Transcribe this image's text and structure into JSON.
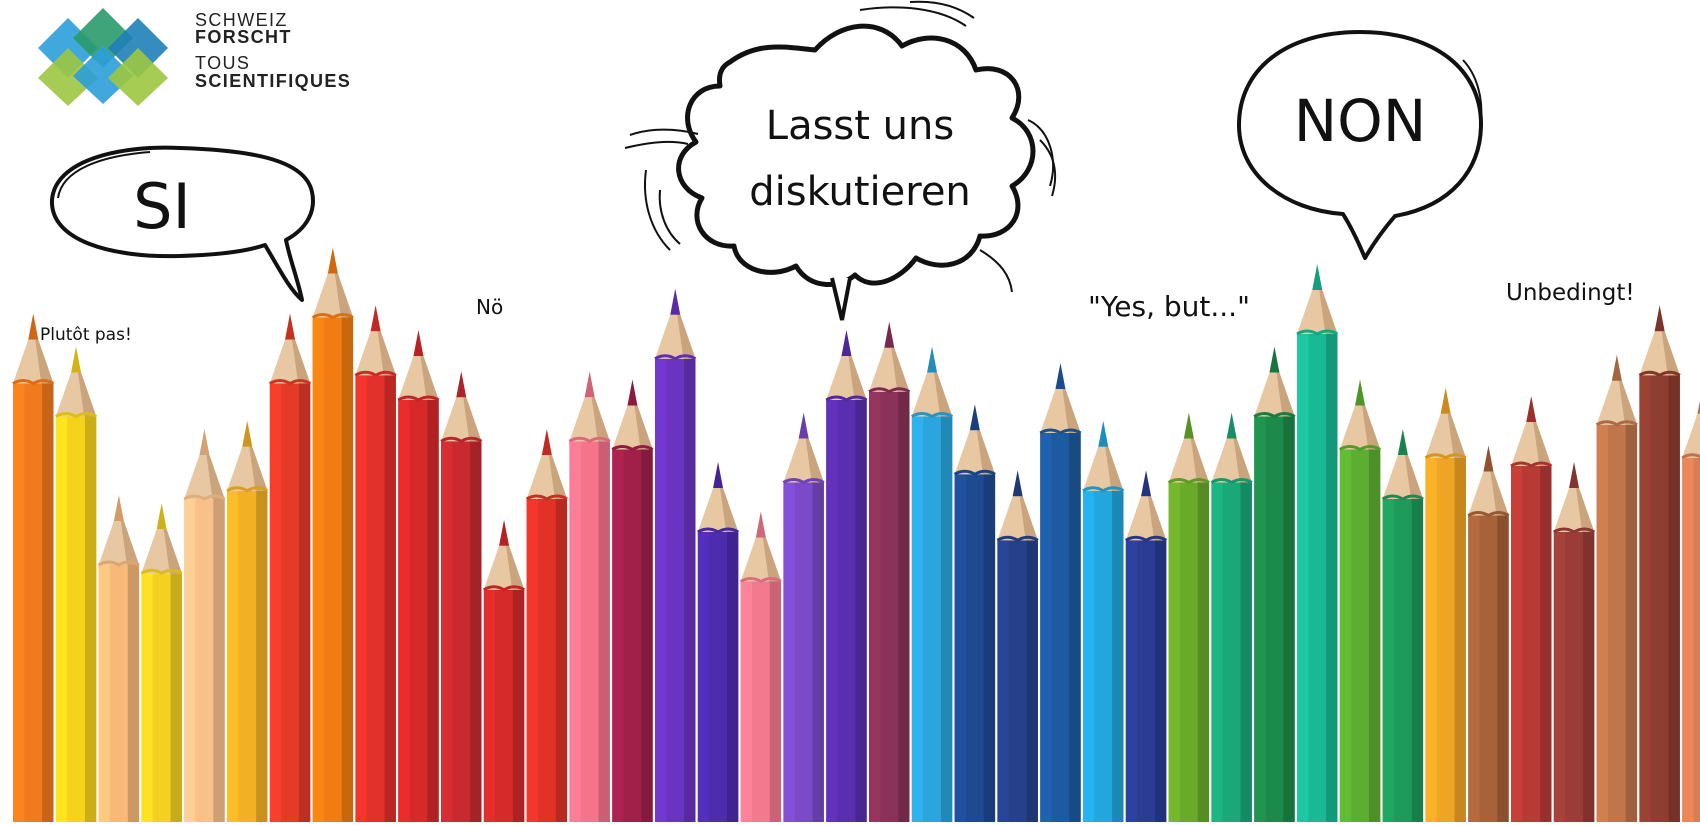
{
  "logo": {
    "line1": "SCHWEIZ",
    "line2": "FORSCHT",
    "line3": "TOUS",
    "line4": "SCIENTIFIQUES",
    "colors": [
      "#2b9fd9",
      "#9cc741",
      "#2a9a6a",
      "#1f7fb8"
    ]
  },
  "bubbles": {
    "si": "SI",
    "discuss_line1": "Lasst uns",
    "discuss_line2": "diskutieren",
    "non": "NON"
  },
  "captions": {
    "plutot": "Plutôt pas!",
    "no": "Nö",
    "yes_but": "\"Yes, but...\"",
    "unbedingt": "Unbedingt!"
  },
  "pencils": [
    {
      "color": "#f07a1c",
      "tip": 0.62
    },
    {
      "color": "#f6d31a",
      "tip": 0.58
    },
    {
      "color": "#f8b878",
      "tip": 0.4
    },
    {
      "color": "#f4d020",
      "tip": 0.39
    },
    {
      "color": "#f9c08a",
      "tip": 0.48
    },
    {
      "color": "#f2b024",
      "tip": 0.49
    },
    {
      "color": "#e43a28",
      "tip": 0.62
    },
    {
      "color": "#f27c12",
      "tip": 0.7
    },
    {
      "color": "#e2302c",
      "tip": 0.63
    },
    {
      "color": "#d8282a",
      "tip": 0.6
    },
    {
      "color": "#c82a30",
      "tip": 0.55
    },
    {
      "color": "#d42a2a",
      "tip": 0.37
    },
    {
      "color": "#e23228",
      "tip": 0.48
    },
    {
      "color": "#f5748c",
      "tip": 0.55
    },
    {
      "color": "#a0204a",
      "tip": 0.54
    },
    {
      "color": "#6a34c0",
      "tip": 0.65
    },
    {
      "color": "#4e2cae",
      "tip": 0.44
    },
    {
      "color": "#f27a8e",
      "tip": 0.38
    },
    {
      "color": "#7a4ac8",
      "tip": 0.5
    },
    {
      "color": "#5a2eb0",
      "tip": 0.6
    },
    {
      "color": "#8a3258",
      "tip": 0.61
    },
    {
      "color": "#2aa6dc",
      "tip": 0.58
    },
    {
      "color": "#1e4a92",
      "tip": 0.51
    },
    {
      "color": "#26418a",
      "tip": 0.43
    },
    {
      "color": "#1e5aa0",
      "tip": 0.56
    },
    {
      "color": "#22a6de",
      "tip": 0.49
    },
    {
      "color": "#2a3c94",
      "tip": 0.43
    },
    {
      "color": "#6aaa2a",
      "tip": 0.5
    },
    {
      "color": "#1aa878",
      "tip": 0.5
    },
    {
      "color": "#1c8a4a",
      "tip": 0.58
    },
    {
      "color": "#1ab894",
      "tip": 0.68
    },
    {
      "color": "#5cae30",
      "tip": 0.54
    },
    {
      "color": "#1e9a5a",
      "tip": 0.48
    },
    {
      "color": "#f0a424",
      "tip": 0.53
    },
    {
      "color": "#a8623a",
      "tip": 0.46
    },
    {
      "color": "#b83a34",
      "tip": 0.52
    },
    {
      "color": "#9a3c38",
      "tip": 0.44
    },
    {
      "color": "#c0764a",
      "tip": 0.57
    },
    {
      "color": "#8e3e30",
      "tip": 0.63
    },
    {
      "color": "#d87e56",
      "tip": 0.53
    }
  ]
}
